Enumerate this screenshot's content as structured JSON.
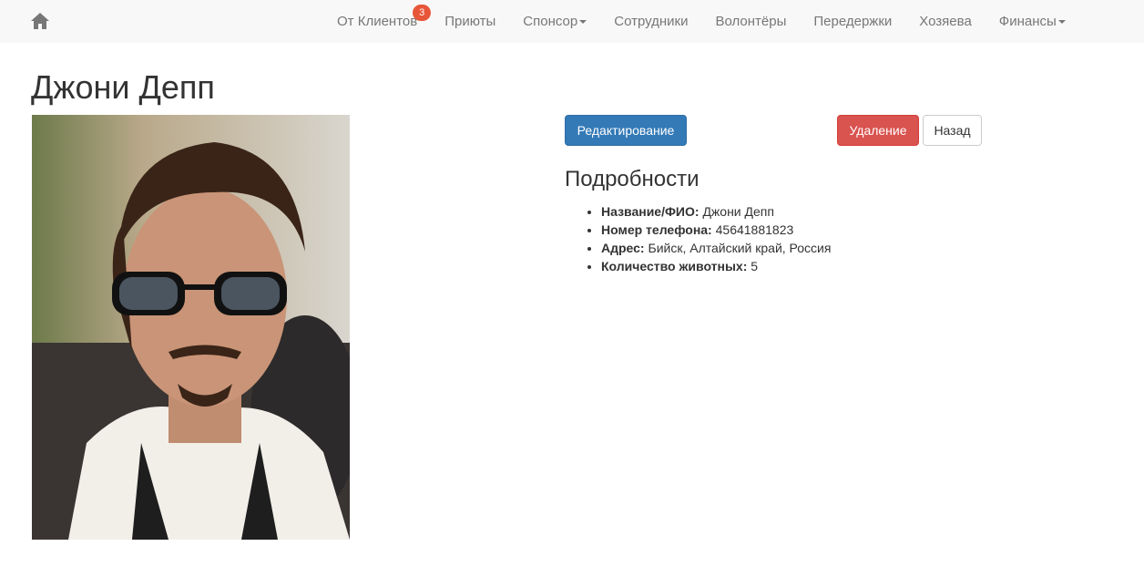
{
  "nav": {
    "home_icon": "home-icon",
    "items": [
      {
        "label": "От Клиентов",
        "badge": "3"
      },
      {
        "label": "Приюты"
      },
      {
        "label": "Спонсор",
        "dropdown": true
      },
      {
        "label": "Сотрудники"
      },
      {
        "label": "Волонтёры"
      },
      {
        "label": "Передержки"
      },
      {
        "label": "Хозяева"
      },
      {
        "label": "Финансы",
        "dropdown": true
      }
    ]
  },
  "page": {
    "title": "Джони Депп"
  },
  "actions": {
    "edit_label": "Редактирование",
    "delete_label": "Удаление",
    "back_label": "Назад"
  },
  "details": {
    "heading": "Подробности",
    "fields": [
      {
        "label": "Название/ФИО:",
        "value": "Джони Депп"
      },
      {
        "label": "Номер телефона:",
        "value": "45641881823"
      },
      {
        "label": "Адрес:",
        "value": "Бийск, Алтайский край, Россия"
      },
      {
        "label": "Количество животных:",
        "value": "5"
      }
    ]
  },
  "colors": {
    "navbar_bg": "#f8f8f8",
    "nav_text": "#777777",
    "badge": "#e8563a",
    "primary": "#337ab7",
    "danger": "#d9534f"
  }
}
